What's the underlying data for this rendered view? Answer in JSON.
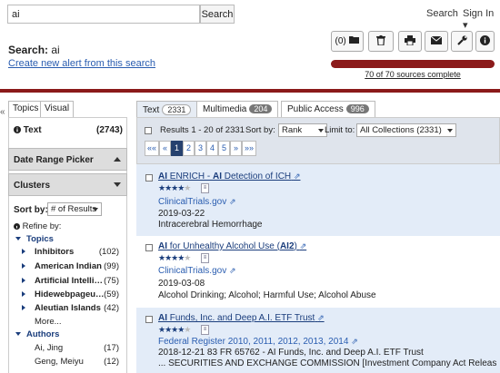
{
  "header": {
    "search_value": "ai",
    "search_button": "Search",
    "search_link": "Search",
    "sign_in": "Sign In",
    "sign_in_caret": "▾"
  },
  "search_summary": {
    "label": "Search:",
    "query": "ai",
    "alert_link": "Create new alert from this search"
  },
  "toolbar": {
    "folder_count": "(0)",
    "progress_text": "70 of 70 sources complete",
    "progress_fraction": 1.0
  },
  "collapse_glyph": "«",
  "left_tabs": [
    "Topics",
    "Visual"
  ],
  "left": {
    "text_label": "Text",
    "text_count": "(2743)",
    "date_picker": "Date Range Picker",
    "clusters": "Clusters",
    "sort_by_label": "Sort by:",
    "sort_by_value": "# of Results",
    "refine_by": "Refine by:",
    "topics_label": "Topics",
    "topics": [
      {
        "label": "Inhibitors",
        "count": "(102)"
      },
      {
        "label": "American Indian",
        "count": "(99)"
      },
      {
        "label": "Artificial Intelli…",
        "count": "(75)"
      },
      {
        "label": "Hidewebpageu…",
        "count": "(59)"
      },
      {
        "label": "Aleutian Islands",
        "count": "(42)"
      }
    ],
    "more": "More...",
    "authors_label": "Authors",
    "authors": [
      {
        "label": "Ai, Jing",
        "count": "(17)"
      },
      {
        "label": "Geng, Meiyu",
        "count": "(12)"
      }
    ]
  },
  "right_tabs": [
    {
      "label": "Text",
      "count": "2331"
    },
    {
      "label": "Multimedia",
      "count": "204"
    },
    {
      "label": "Public Access",
      "count": "996"
    }
  ],
  "results_bar": {
    "range": "Results 1 - 20 of 2331",
    "sort_label": "Sort by:",
    "sort_value": "Rank",
    "limit_label": "Limit to:",
    "limit_value": "All Collections (2331)",
    "pages": [
      "««",
      "«",
      "1",
      "2",
      "3",
      "4",
      "5",
      "»",
      "»»"
    ],
    "current_page": "1"
  },
  "results": [
    {
      "title_bold1": "AI",
      "title_mid": " ENRICH - ",
      "title_bold2": "AI",
      "title_rest": " Detection of ICH",
      "rating": 4,
      "source": "ClinicalTrials.gov",
      "date": "2019-03-22",
      "detail": "Intracerebral Hemorrhage"
    },
    {
      "title_bold1": "AI",
      "title_mid": " for Unhealthy Alcohol Use (",
      "title_bold2": "AI2",
      "title_rest": ")",
      "rating": 4,
      "source": "ClinicalTrials.gov",
      "date": "2019-03-08",
      "detail": "Alcohol Drinking; Alcohol; Harmful Use; Alcohol Abuse"
    },
    {
      "title_bold1": "AI",
      "title_mid": " Funds, Inc. and Deep A.I. ETF Trust",
      "title_bold2": "",
      "title_rest": "",
      "rating": 4,
      "source": "Federal Register 2010, 2011, 2012, 2013, 2014",
      "date": "2018-12-21 83 FR 65762 - AI Funds, Inc. and Deep A.I. ETF Trust",
      "detail": "... SECURITIES AND EXCHANGE COMMISSION [Investment Company Act Release No."
    }
  ],
  "colors": {
    "accent": "#8b1a1a",
    "link": "#2a5db0",
    "highlight": "#e3ecf8",
    "bar": "#dfe4ec"
  }
}
